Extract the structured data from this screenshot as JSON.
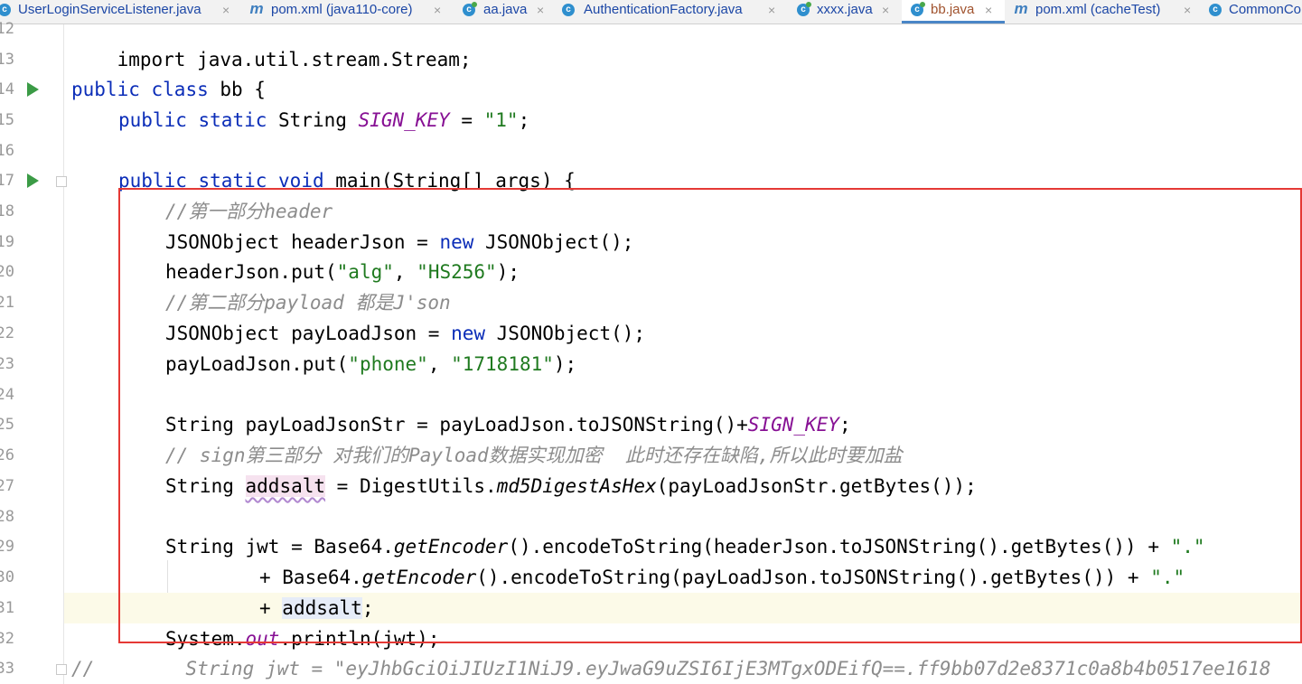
{
  "tabs": [
    {
      "label": "UserLoginServiceListener.java",
      "icon": "java-class-icon",
      "active": false
    },
    {
      "label": "pom.xml (java110-core)",
      "icon": "maven-icon",
      "active": false
    },
    {
      "label": "aa.java",
      "icon": "java-class-icon",
      "active": false
    },
    {
      "label": "AuthenticationFactory.java",
      "icon": "java-class-icon",
      "active": false
    },
    {
      "label": "xxxx.java",
      "icon": "java-class-icon",
      "active": false
    },
    {
      "label": "bb.java",
      "icon": "java-class-icon",
      "active": true
    },
    {
      "label": "pom.xml (cacheTest)",
      "icon": "maven-icon",
      "active": false
    },
    {
      "label": "CommonCo",
      "icon": "java-class-icon",
      "active": false
    }
  ],
  "close_glyph": "×",
  "icon_glyphs": {
    "java": "c",
    "maven": "m"
  },
  "line_numbers": [
    "12",
    "13",
    "14",
    "15",
    "16",
    "17",
    "18",
    "19",
    "20",
    "21",
    "22",
    "23",
    "24",
    "25",
    "26",
    "27",
    "28",
    "29",
    "30",
    "31",
    "32",
    "33"
  ],
  "code": {
    "l12": "import java.util.stream.Stream;",
    "l14": {
      "kw1": "public",
      "kw2": "class",
      "rest": " bb {"
    },
    "l15": {
      "kw1": "public",
      "kw2": "static",
      "type": " String ",
      "const": "SIGN_KEY",
      "eq": " = ",
      "str": "\"1\"",
      "end": ";"
    },
    "l17": {
      "kw1": "public",
      "kw2": "static",
      "kw3": "void",
      "rest": " main(String[] args) {"
    },
    "l18": "//第一部分header",
    "l19": {
      "a": "JSONObject headerJson = ",
      "kw": "new",
      "b": " JSONObject();"
    },
    "l20": {
      "a": "headerJson.put(",
      "s1": "\"alg\"",
      "c": ", ",
      "s2": "\"HS256\"",
      "d": ");"
    },
    "l21": "//第二部分payload 都是J'son",
    "l22": {
      "a": "JSONObject payLoadJson = ",
      "kw": "new",
      "b": " JSONObject();"
    },
    "l23": {
      "a": "payLoadJson.put(",
      "s1": "\"phone\"",
      "c": ", ",
      "s2": "\"1718181\"",
      "d": ");"
    },
    "l25": {
      "a": "String payLoadJsonStr = payLoadJson.toJSONString()+",
      "const": "SIGN_KEY",
      "b": ";"
    },
    "l26": "// sign第三部分 对我们的Payload数据实现加密  此时还存在缺陷,所以此时要加盐",
    "l27": {
      "a": "String ",
      "var": "addsalt",
      "b": " = DigestUtils.",
      "m": "md5DigestAsHex",
      "c": "(payLoadJsonStr.getBytes());"
    },
    "l29": {
      "a": "String jwt = Base64.",
      "m": "getEncoder",
      "b": "().encodeToString(headerJson.toJSONString().getBytes()) + ",
      "s": "\".\""
    },
    "l30": {
      "a": "+ Base64.",
      "m": "getEncoder",
      "b": "().encodeToString(payLoadJson.toJSONString().getBytes()) + ",
      "s": "\".\""
    },
    "l31": {
      "a": "+ ",
      "var": "addsalt",
      "b": ";"
    },
    "l32": {
      "a": "System.",
      "f": "out",
      "b": ".println(jwt);"
    },
    "l33": "//        String jwt = \"eyJhbGciOiJIUzI1NiJ9.eyJwaG9uZSI6IjE3MTgxODEifQ==.ff9bb07d2e8371c0a8b4b0517ee1618"
  },
  "colors": {
    "keyword": "#0b2db8",
    "string": "#1f7a1f",
    "comment": "#8c8c8c",
    "constant": "#871094",
    "annotation_box": "#e53935",
    "run_icon": "#3b9b46"
  }
}
